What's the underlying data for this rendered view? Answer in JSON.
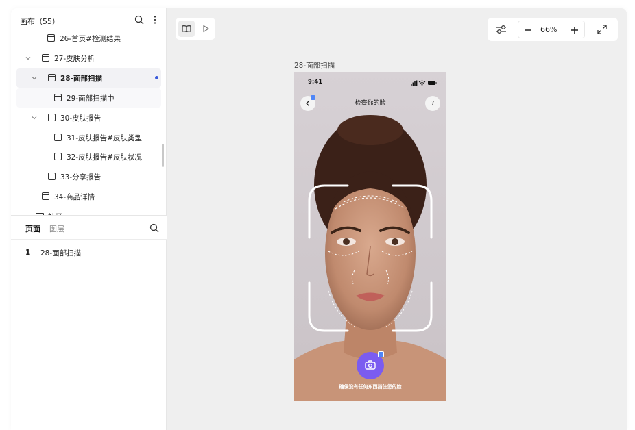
{
  "sidebar": {
    "title": "画布（55）",
    "tree": [
      {
        "label": "26-首页#检测结果"
      },
      {
        "label": "27-皮肤分析"
      },
      {
        "label": "28-面部扫描"
      },
      {
        "label": "29-面部扫描中"
      },
      {
        "label": "30-皮肤报告"
      },
      {
        "label": "31-皮肤报告#皮肤类型"
      },
      {
        "label": "32-皮肤报告#皮肤状况"
      },
      {
        "label": "33-分享报告"
      },
      {
        "label": "34-商品详情"
      },
      {
        "label": "社区"
      }
    ],
    "tabs": {
      "pages": "页面",
      "layers": "图层"
    },
    "pages": [
      {
        "num": "1",
        "name": "28-面部扫描"
      }
    ]
  },
  "toolbar": {
    "zoom": "66%"
  },
  "artboard": {
    "title": "28-面部扫描",
    "time": "9:41",
    "screen_title": "检查你的脸",
    "help": "?",
    "hint": "确保没有任何东西挡住您的脸"
  },
  "colors": {
    "accent": "#7b5cf0",
    "selection_dot": "#3b5bdb",
    "badge": "#4f86f7"
  }
}
